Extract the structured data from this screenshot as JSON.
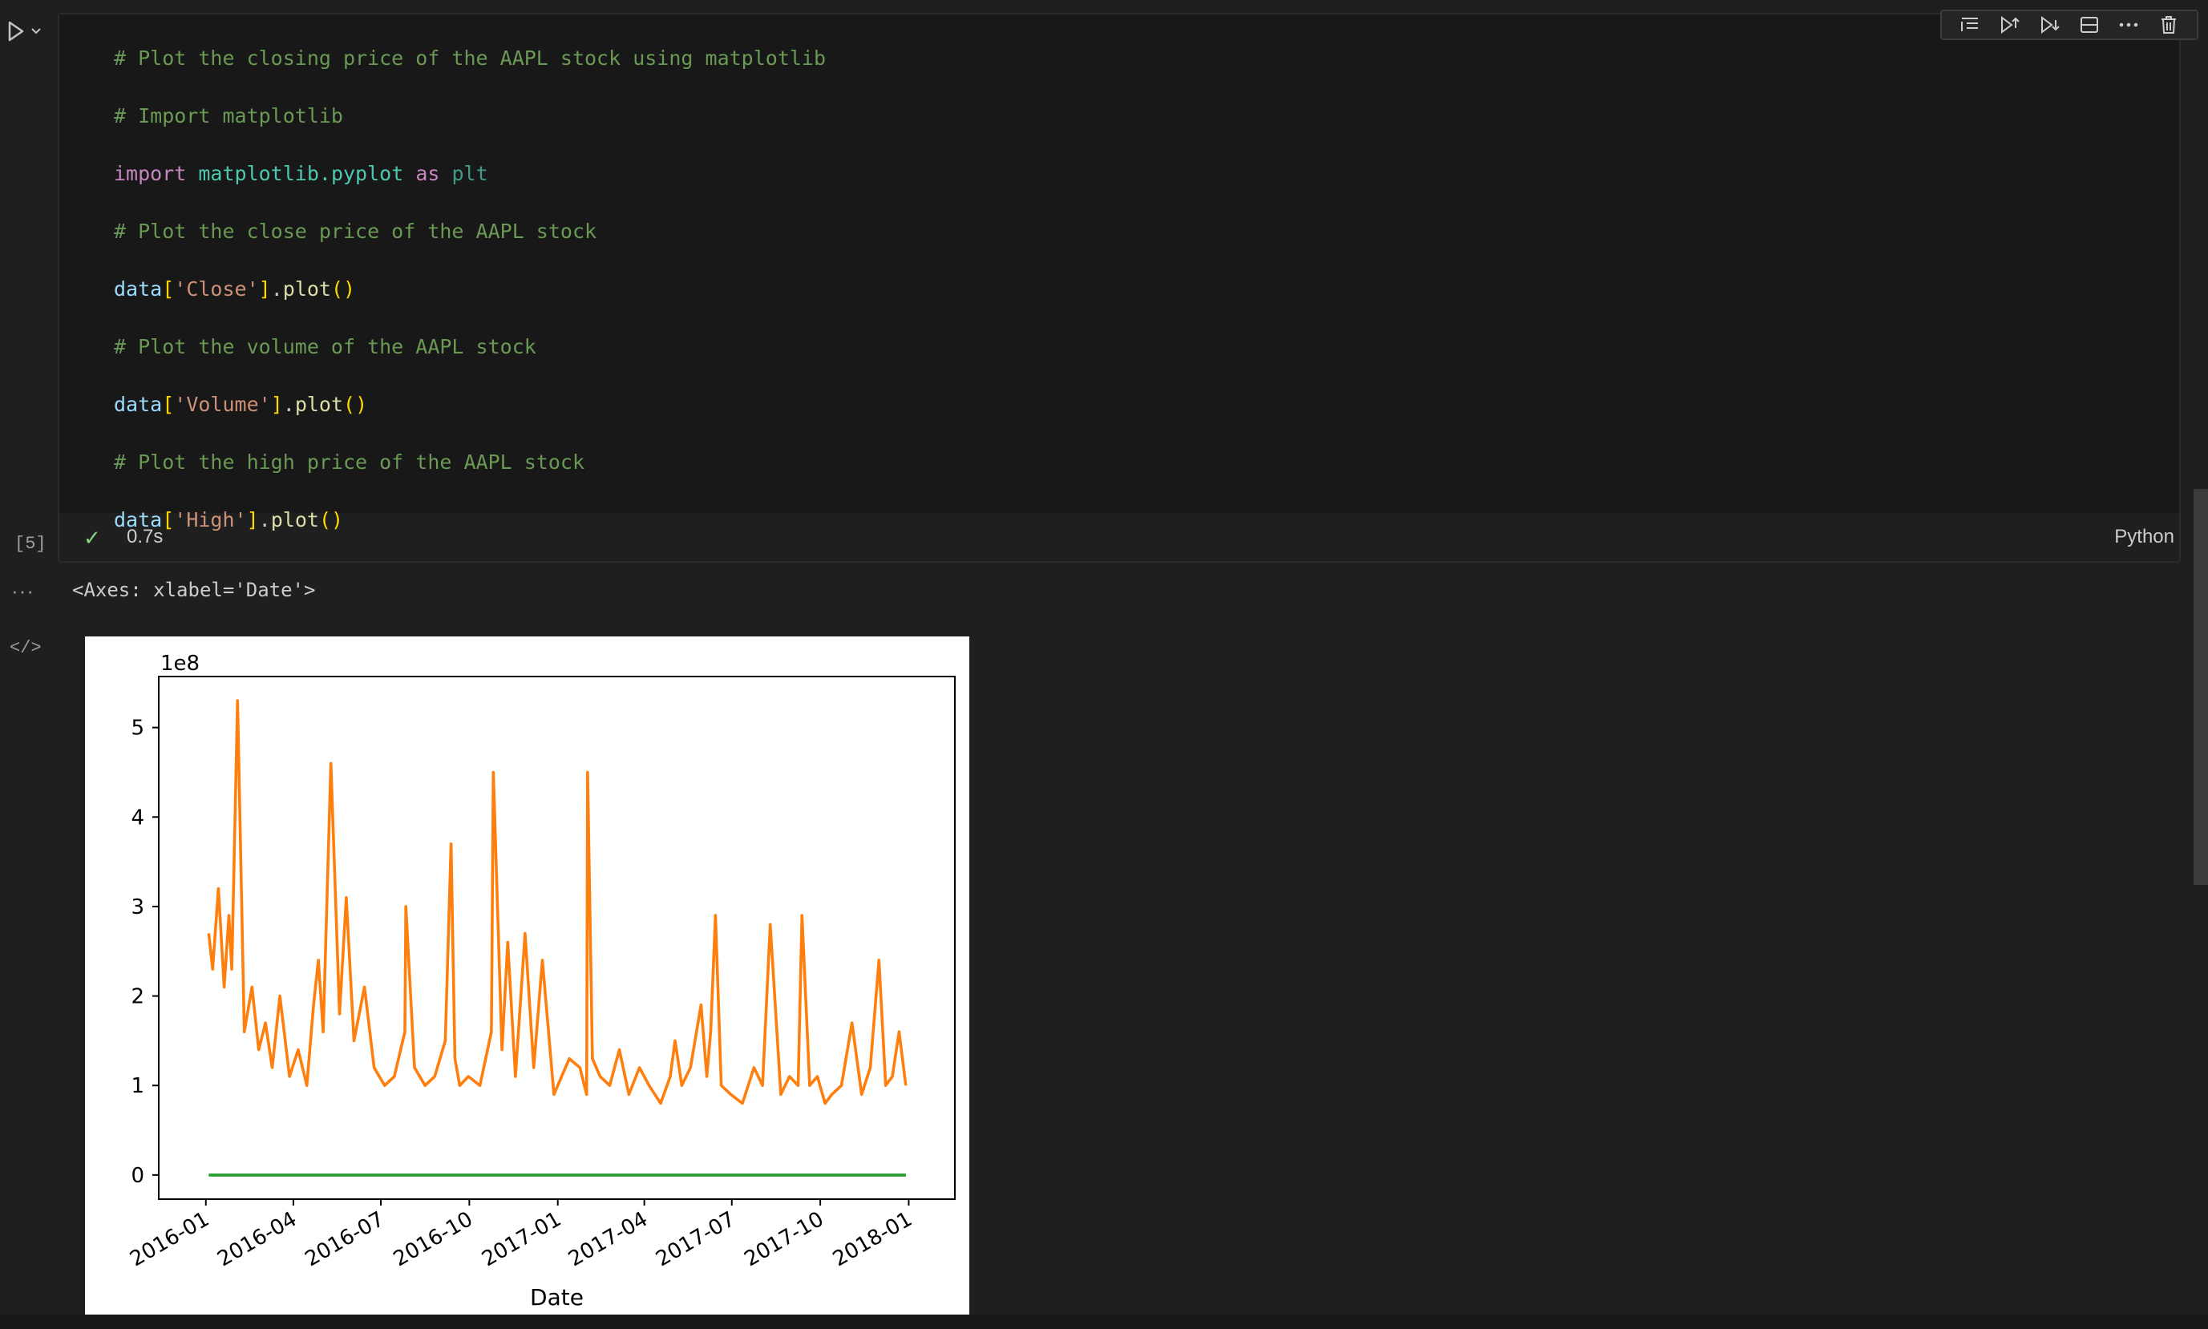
{
  "cell": {
    "execution_count": "[5]",
    "status_check": "✓",
    "duration": "0.7s",
    "language": "Python",
    "code_lines": [
      [
        {
          "c": "cm",
          "t": "# Plot the closing price of the AAPL stock using matplotlib"
        }
      ],
      [
        {
          "c": "cm",
          "t": "# Import matplotlib"
        }
      ],
      [
        {
          "c": "kw",
          "t": "import"
        },
        {
          "c": "pu",
          "t": " "
        },
        {
          "c": "mod",
          "t": "matplotlib.pyplot"
        },
        {
          "c": "pu",
          "t": " "
        },
        {
          "c": "kw",
          "t": "as"
        },
        {
          "c": "pu",
          "t": " "
        },
        {
          "c": "alias",
          "t": "plt"
        }
      ],
      [
        {
          "c": "cm",
          "t": "# Plot the close price of the AAPL stock"
        }
      ],
      [
        {
          "c": "var",
          "t": "data"
        },
        {
          "c": "br",
          "t": "["
        },
        {
          "c": "str",
          "t": "'Close'"
        },
        {
          "c": "br",
          "t": "]"
        },
        {
          "c": "pu",
          "t": "."
        },
        {
          "c": "fn",
          "t": "plot"
        },
        {
          "c": "br",
          "t": "()"
        }
      ],
      [
        {
          "c": "cm",
          "t": "# Plot the volume of the AAPL stock"
        }
      ],
      [
        {
          "c": "var",
          "t": "data"
        },
        {
          "c": "br",
          "t": "["
        },
        {
          "c": "str",
          "t": "'Volume'"
        },
        {
          "c": "br",
          "t": "]"
        },
        {
          "c": "pu",
          "t": "."
        },
        {
          "c": "fn",
          "t": "plot"
        },
        {
          "c": "br",
          "t": "()"
        }
      ],
      [
        {
          "c": "cm",
          "t": "# Plot the high price of the AAPL stock"
        }
      ],
      [
        {
          "c": "var",
          "t": "data"
        },
        {
          "c": "br",
          "t": "["
        },
        {
          "c": "str",
          "t": "'High'"
        },
        {
          "c": "br",
          "t": "]"
        },
        {
          "c": "pu",
          "t": "."
        },
        {
          "c": "fn",
          "t": "plot"
        },
        {
          "c": "br",
          "t": "()"
        }
      ]
    ],
    "toolbar": [
      "execute-above-icon",
      "execute-below-icon",
      "execute-and-below-icon",
      "split-cell-icon",
      "more-icon",
      "delete-icon"
    ]
  },
  "output": {
    "dots": "···",
    "code_icon": "</>",
    "text": "<Axes: xlabel='Date'>"
  },
  "chart_data": {
    "type": "line",
    "xlabel": "Date",
    "ylabel": "",
    "offset_text": "1e8",
    "ylim": [
      -0.27,
      5.57
    ],
    "yticks": [
      0,
      1,
      2,
      3,
      4,
      5
    ],
    "x_range": [
      "2015-11-13",
      "2018-02-18"
    ],
    "xticks": [
      "2016-01",
      "2016-04",
      "2016-07",
      "2016-10",
      "2017-01",
      "2017-04",
      "2017-07",
      "2017-10",
      "2018-01"
    ],
    "colors": {
      "Close": "#1f77b4",
      "Volume": "#ff7f0e",
      "High": "#2ca02c"
    },
    "series": [
      {
        "name": "Close",
        "x": [
          "2016-01-04",
          "2017-12-29"
        ],
        "y": [
          0,
          0
        ]
      },
      {
        "name": "Volume",
        "x": [
          "2016-01-04",
          "2016-01-08",
          "2016-01-14",
          "2016-01-20",
          "2016-01-25",
          "2016-01-28",
          "2016-02-03",
          "2016-02-10",
          "2016-02-18",
          "2016-02-25",
          "2016-03-03",
          "2016-03-10",
          "2016-03-18",
          "2016-03-28",
          "2016-04-06",
          "2016-04-15",
          "2016-04-22",
          "2016-04-27",
          "2016-05-02",
          "2016-05-10",
          "2016-05-19",
          "2016-05-26",
          "2016-06-03",
          "2016-06-14",
          "2016-06-24",
          "2016-07-05",
          "2016-07-15",
          "2016-07-26",
          "2016-07-27",
          "2016-08-05",
          "2016-08-16",
          "2016-08-26",
          "2016-09-06",
          "2016-09-12",
          "2016-09-16",
          "2016-09-21",
          "2016-09-30",
          "2016-10-12",
          "2016-10-24",
          "2016-10-26",
          "2016-11-04",
          "2016-11-10",
          "2016-11-18",
          "2016-11-28",
          "2016-12-07",
          "2016-12-16",
          "2016-12-28",
          "2017-01-05",
          "2017-01-13",
          "2017-01-24",
          "2017-01-31",
          "2017-02-01",
          "2017-02-06",
          "2017-02-14",
          "2017-02-24",
          "2017-03-06",
          "2017-03-16",
          "2017-03-27",
          "2017-04-06",
          "2017-04-18",
          "2017-04-28",
          "2017-05-03",
          "2017-05-10",
          "2017-05-19",
          "2017-05-30",
          "2017-06-05",
          "2017-06-09",
          "2017-06-14",
          "2017-06-20",
          "2017-06-30",
          "2017-07-12",
          "2017-07-24",
          "2017-08-02",
          "2017-08-10",
          "2017-08-21",
          "2017-08-30",
          "2017-09-08",
          "2017-09-12",
          "2017-09-20",
          "2017-09-28",
          "2017-10-06",
          "2017-10-13",
          "2017-10-23",
          "2017-11-03",
          "2017-11-13",
          "2017-11-22",
          "2017-12-01",
          "2017-12-08",
          "2017-12-15",
          "2017-12-22",
          "2017-12-29"
        ],
        "y": [
          2.7,
          2.3,
          3.2,
          2.1,
          2.9,
          2.3,
          5.3,
          1.6,
          2.1,
          1.4,
          1.7,
          1.2,
          2.0,
          1.1,
          1.4,
          1.0,
          1.9,
          2.4,
          1.6,
          4.6,
          1.8,
          3.1,
          1.5,
          2.1,
          1.2,
          1.0,
          1.1,
          1.6,
          3.0,
          1.2,
          1.0,
          1.1,
          1.5,
          3.7,
          1.3,
          1.0,
          1.1,
          1.0,
          1.6,
          4.5,
          1.4,
          2.6,
          1.1,
          2.7,
          1.2,
          2.4,
          0.9,
          1.1,
          1.3,
          1.2,
          0.9,
          4.5,
          1.3,
          1.1,
          1.0,
          1.4,
          0.9,
          1.2,
          1.0,
          0.8,
          1.1,
          1.5,
          1.0,
          1.2,
          1.9,
          1.1,
          1.6,
          2.9,
          1.0,
          0.9,
          0.8,
          1.2,
          1.0,
          2.8,
          0.9,
          1.1,
          1.0,
          2.9,
          1.0,
          1.1,
          0.8,
          0.9,
          1.0,
          1.7,
          0.9,
          1.2,
          2.4,
          1.0,
          1.1,
          1.6,
          1.0
        ]
      },
      {
        "name": "High",
        "x": [
          "2016-01-04",
          "2017-12-29"
        ],
        "y": [
          0,
          0
        ]
      }
    ]
  }
}
